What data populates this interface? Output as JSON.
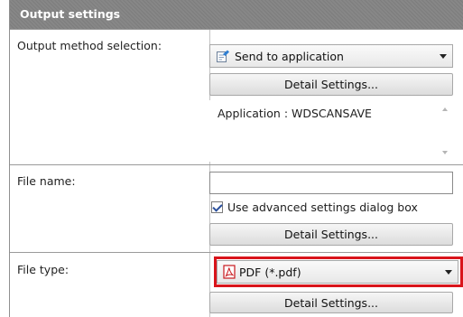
{
  "panel": {
    "title": "Output settings"
  },
  "output_method": {
    "label": "Output method selection:",
    "selected": "Send to application",
    "detail_button": "Detail Settings...",
    "application_text": "Application : WDSCANSAVE"
  },
  "file_name": {
    "label": "File name:",
    "value": "",
    "checkbox_label": "Use advanced settings dialog box",
    "checkbox_checked": true,
    "detail_button": "Detail Settings..."
  },
  "file_type": {
    "label": "File type:",
    "selected": "PDF (*.pdf)",
    "detail_button": "Detail Settings..."
  },
  "colors": {
    "highlight": "#d9141b",
    "pdf_icon": "#c8171d",
    "header_bg": "#808080"
  },
  "icons": {
    "send_app": "send-to-application-icon",
    "pdf": "pdf-file-icon"
  }
}
